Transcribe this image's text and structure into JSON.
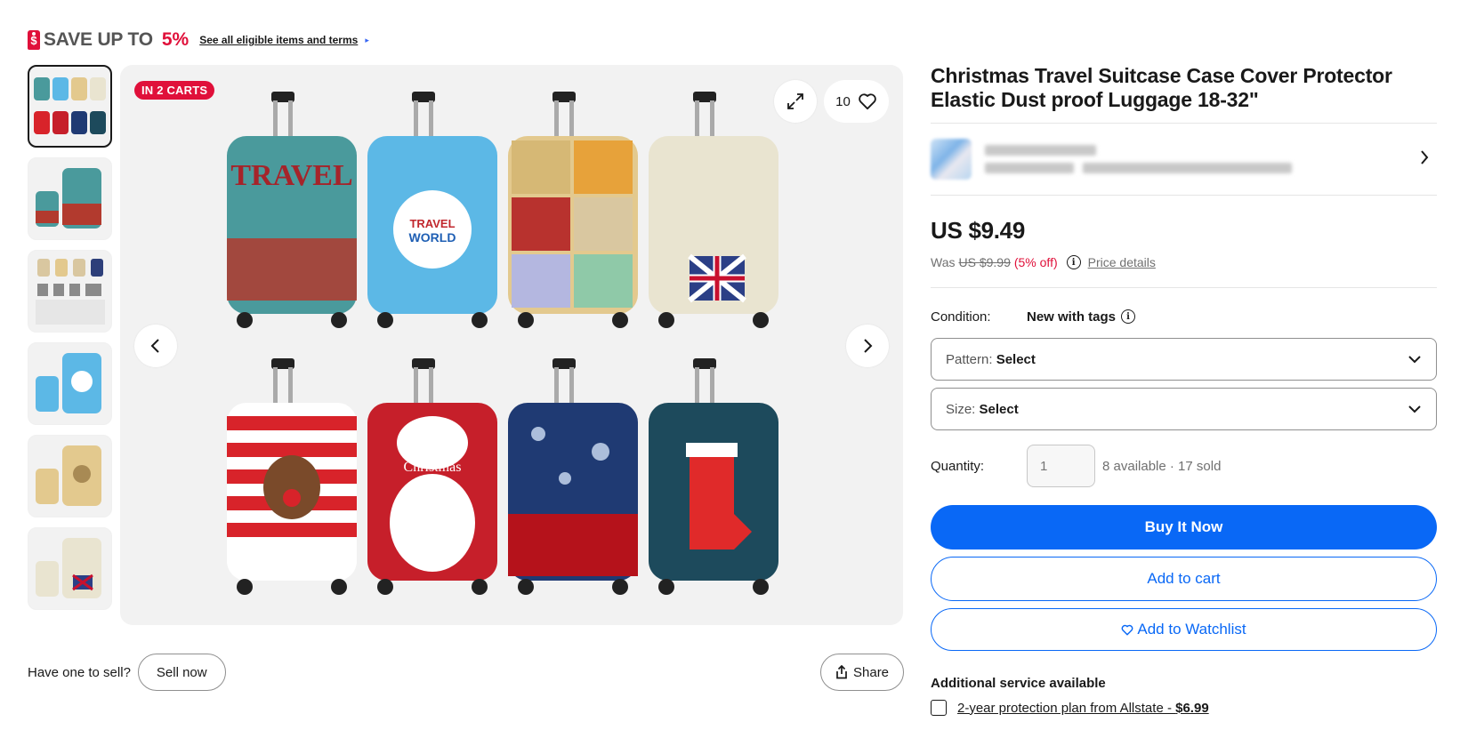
{
  "promo": {
    "tag_icon": "sale-tag-icon",
    "text": "SAVE UP TO",
    "percent": "5%",
    "link": "See all eligible items and terms",
    "link_arrow": "▸"
  },
  "gallery": {
    "badge": "IN 2 CARTS",
    "watch_count": "10",
    "thumbnail_count": 6,
    "main_colors": [
      "#4a9a9c",
      "#5cb8e6",
      "#e9d8a6",
      "#e9e4d0",
      "#d8232a",
      "#c61f2a",
      "#1f3a73",
      "#1d4a5c"
    ]
  },
  "sell": {
    "label": "Have one to sell?",
    "button": "Sell now"
  },
  "share": {
    "button": "Share"
  },
  "listing": {
    "title": "Christmas Travel Suitcase Case Cover Protector Elastic Dust proof Luggage 18-32\"",
    "price": "US $9.49",
    "was_label": "Was",
    "was_price": "US $9.99",
    "discount": "(5% off)",
    "price_details": "Price details",
    "condition_label": "Condition:",
    "condition_value": "New with tags",
    "pattern_label": "Pattern:",
    "pattern_value": "Select",
    "size_label": "Size:",
    "size_value": "Select",
    "quantity_label": "Quantity:",
    "quantity_placeholder": "1",
    "availability": "8 available · 17 sold",
    "buy_now": "Buy It Now",
    "add_to_cart": "Add to cart",
    "add_to_watchlist": "Add to Watchlist",
    "additional_service": "Additional service available",
    "protection_plan": "2-year protection plan from Allstate - ",
    "protection_price": "$6.99"
  },
  "colors": {
    "accent_blue": "#0968f6",
    "sale_red": "#e0103a",
    "text": "#191919",
    "muted": "#707070"
  }
}
